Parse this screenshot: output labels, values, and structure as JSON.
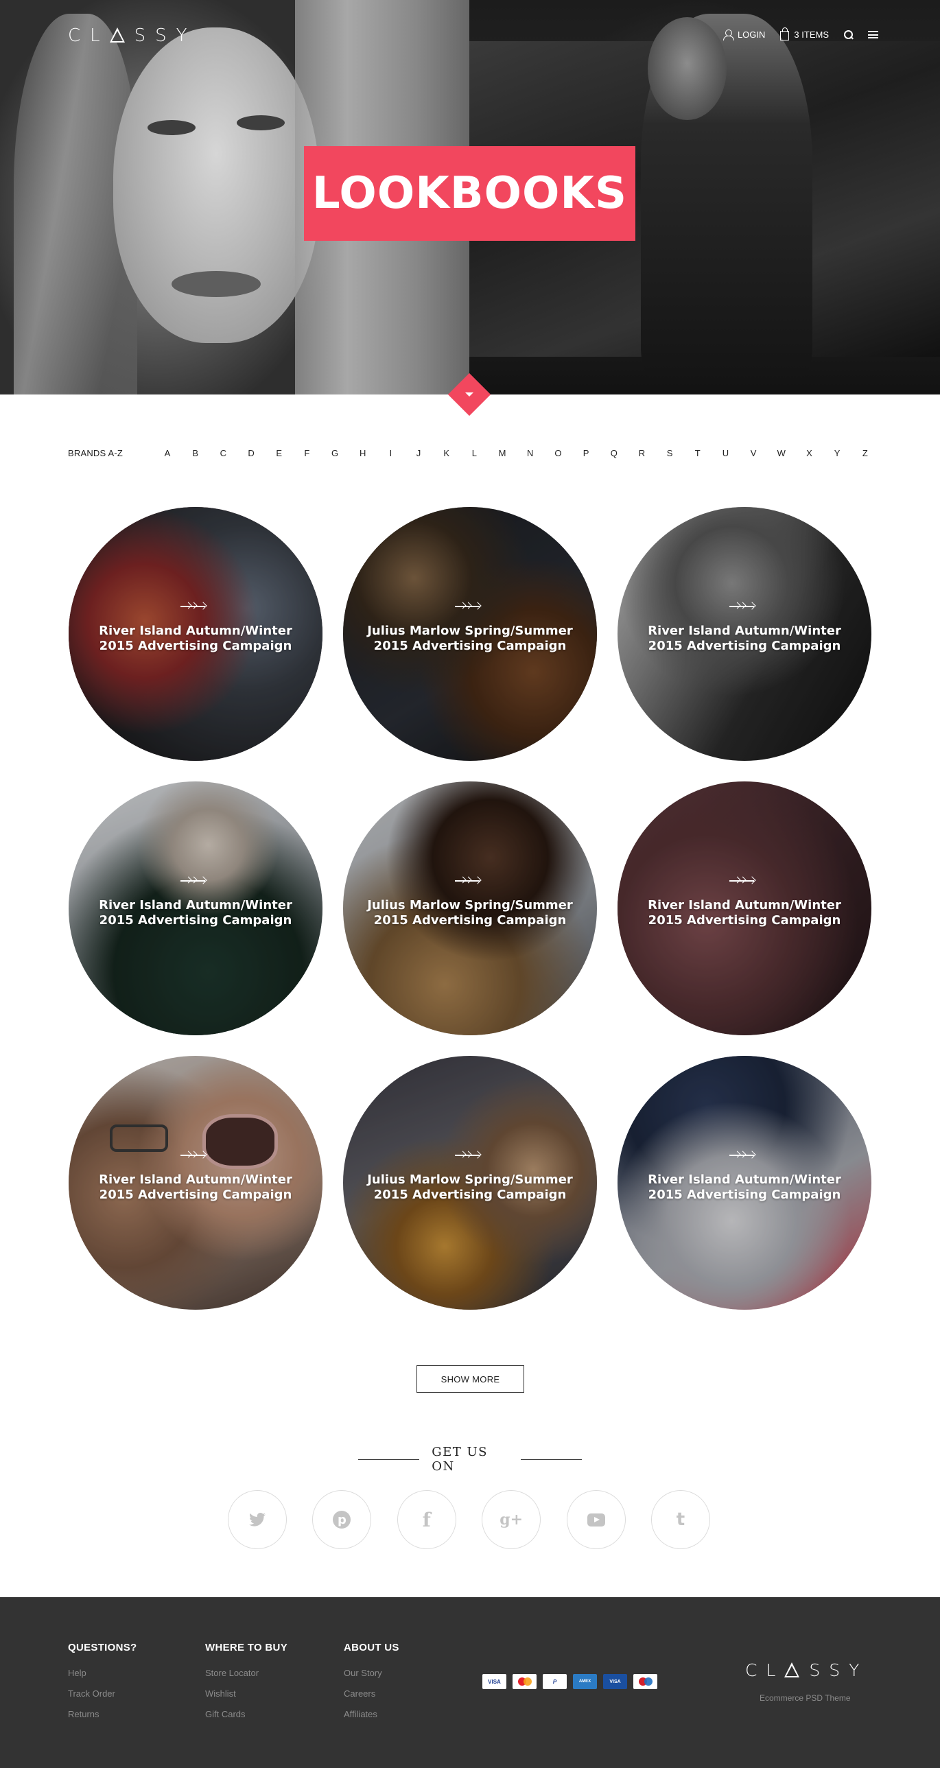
{
  "brand": {
    "logo_text": "CLASSY",
    "logo_before": "CL",
    "logo_after": "SSY"
  },
  "header": {
    "login_label": "LOGIN",
    "cart_label": "3 ITEMS"
  },
  "hero": {
    "title": "LOOKBOOKS"
  },
  "colors": {
    "accent": "#f2475e",
    "footer_bg": "#333333"
  },
  "brands_az": {
    "label": "BRANDS A-Z",
    "letters": [
      "A",
      "B",
      "C",
      "D",
      "E",
      "F",
      "G",
      "H",
      "I",
      "J",
      "K",
      "L",
      "M",
      "N",
      "O",
      "P",
      "Q",
      "R",
      "S",
      "T",
      "U",
      "V",
      "W",
      "X",
      "Y",
      "Z"
    ]
  },
  "lookbooks": [
    {
      "title": "River Island Autumn/Winter 2015 Advertising Campaign"
    },
    {
      "title": "Julius Marlow Spring/Summer 2015 Advertising Campaign"
    },
    {
      "title": "River Island Autumn/Winter 2015 Advertising Campaign"
    },
    {
      "title": "River Island Autumn/Winter 2015 Advertising Campaign"
    },
    {
      "title": "Julius Marlow Spring/Summer 2015 Advertising Campaign"
    },
    {
      "title": "River Island Autumn/Winter 2015 Advertising Campaign"
    },
    {
      "title": "River Island Autumn/Winter 2015 Advertising Campaign"
    },
    {
      "title": "Julius Marlow Spring/Summer 2015 Advertising Campaign"
    },
    {
      "title": "River Island Autumn/Winter 2015 Advertising Campaign"
    }
  ],
  "show_more_label": "SHOW MORE",
  "social": {
    "heading": "GET US ON",
    "networks": [
      "twitter-icon",
      "pinterest-icon",
      "facebook-icon",
      "google-plus-icon",
      "youtube-icon",
      "tumblr-icon"
    ]
  },
  "footer": {
    "questions": {
      "heading": "QUESTIONS?",
      "links": [
        "Help",
        "Track Order",
        "Returns"
      ]
    },
    "where_to_buy": {
      "heading": "WHERE TO BUY",
      "links": [
        "Store Locator",
        "Wishlist",
        "Gift Cards"
      ]
    },
    "about_us": {
      "heading": "ABOUT US",
      "links": [
        "Our Story",
        "Careers",
        "Affiliates"
      ]
    },
    "payment_cards": [
      "VISA",
      "MasterCard",
      "PayPal",
      "American Express",
      "VISA Electron",
      "Maestro"
    ],
    "tagline": "Ecommerce PSD Theme"
  }
}
